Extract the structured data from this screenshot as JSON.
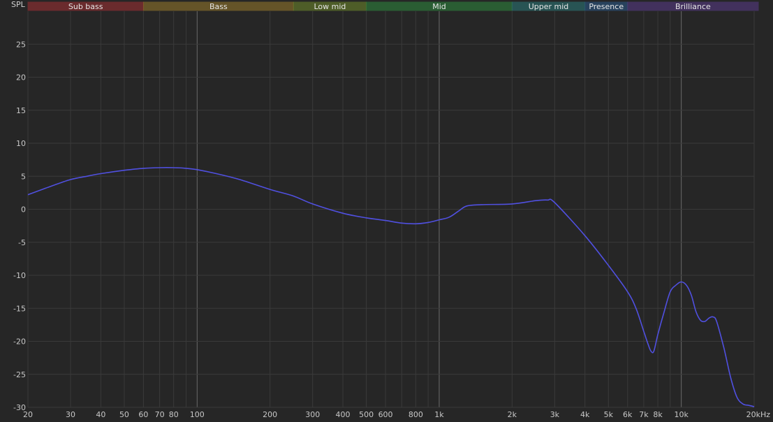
{
  "chart_data": {
    "type": "line",
    "ylabel": "SPL",
    "xlabel": "",
    "xscale": "log",
    "xlim": [
      20,
      20000
    ],
    "ylim": [
      -30,
      30
    ],
    "grid": true,
    "x_ticks": [
      {
        "value": 20,
        "label": "20"
      },
      {
        "value": 30,
        "label": "30"
      },
      {
        "value": 40,
        "label": "40"
      },
      {
        "value": 50,
        "label": "50"
      },
      {
        "value": 60,
        "label": "60"
      },
      {
        "value": 70,
        "label": "70"
      },
      {
        "value": 80,
        "label": "80"
      },
      {
        "value": 100,
        "label": "100"
      },
      {
        "value": 200,
        "label": "200"
      },
      {
        "value": 300,
        "label": "300"
      },
      {
        "value": 400,
        "label": "400"
      },
      {
        "value": 500,
        "label": "500"
      },
      {
        "value": 600,
        "label": "600"
      },
      {
        "value": 800,
        "label": "800"
      },
      {
        "value": 1000,
        "label": "1k"
      },
      {
        "value": 2000,
        "label": "2k"
      },
      {
        "value": 3000,
        "label": "3k"
      },
      {
        "value": 4000,
        "label": "4k"
      },
      {
        "value": 5000,
        "label": "5k"
      },
      {
        "value": 6000,
        "label": "6k"
      },
      {
        "value": 7000,
        "label": "7k"
      },
      {
        "value": 8000,
        "label": "8k"
      },
      {
        "value": 10000,
        "label": "10k"
      },
      {
        "value": 20000,
        "label": "20kHz"
      }
    ],
    "y_ticks": [
      {
        "value": 25,
        "label": "25"
      },
      {
        "value": 20,
        "label": "20"
      },
      {
        "value": 15,
        "label": "15"
      },
      {
        "value": 10,
        "label": "10"
      },
      {
        "value": 5,
        "label": "5"
      },
      {
        "value": 0,
        "label": "0"
      },
      {
        "value": -5,
        "label": "-5"
      },
      {
        "value": -10,
        "label": "-10"
      },
      {
        "value": -15,
        "label": "-15"
      },
      {
        "value": -20,
        "label": "-20"
      },
      {
        "value": -25,
        "label": "-25"
      },
      {
        "value": -30,
        "label": "-30"
      }
    ],
    "bands": [
      {
        "label": "Sub bass",
        "from": 20,
        "to": 60,
        "color": "#a33033"
      },
      {
        "label": "Bass",
        "from": 60,
        "to": 250,
        "color": "#9a7a2a"
      },
      {
        "label": "Low mid",
        "from": 250,
        "to": 500,
        "color": "#6f8a2a"
      },
      {
        "label": "Mid",
        "from": 500,
        "to": 2000,
        "color": "#2f8a3f"
      },
      {
        "label": "Upper mid",
        "from": 2000,
        "to": 4000,
        "color": "#2a7a7a"
      },
      {
        "label": "Presence",
        "from": 4000,
        "to": 6000,
        "color": "#2a5a8a"
      },
      {
        "label": "Brilliance",
        "from": 6000,
        "to": 20000,
        "color": "#5a3a8a"
      }
    ],
    "series": [
      {
        "color": "#5050e0",
        "x": [
          20,
          25,
          30,
          35,
          40,
          50,
          60,
          70,
          80,
          90,
          100,
          120,
          150,
          200,
          250,
          300,
          400,
          500,
          600,
          700,
          800,
          900,
          1000,
          1100,
          1200,
          1300,
          1500,
          2000,
          2500,
          2800,
          3000,
          4000,
          5000,
          6000,
          6500,
          7000,
          7300,
          7500,
          7700,
          8000,
          8500,
          9000,
          9500,
          10000,
          10500,
          11000,
          11500,
          12000,
          12500,
          13000,
          13500,
          14000,
          15000,
          16000,
          17000,
          18000,
          19000,
          20000
        ],
        "y": [
          2.2,
          3.5,
          4.5,
          5.0,
          5.4,
          5.9,
          6.2,
          6.3,
          6.3,
          6.2,
          6.0,
          5.4,
          4.5,
          3.0,
          2.0,
          0.8,
          -0.6,
          -1.3,
          -1.7,
          -2.1,
          -2.2,
          -2.0,
          -1.6,
          -1.2,
          -0.3,
          0.5,
          0.7,
          0.8,
          1.3,
          1.4,
          1.0,
          -4.0,
          -8.5,
          -12.5,
          -15.0,
          -18.5,
          -20.5,
          -21.5,
          -21.5,
          -19.0,
          -15.5,
          -12.5,
          -11.5,
          -11.0,
          -11.5,
          -13.0,
          -15.5,
          -16.8,
          -17.0,
          -16.5,
          -16.3,
          -17.0,
          -21.0,
          -25.5,
          -28.5,
          -29.5,
          -29.7,
          -29.9
        ]
      }
    ]
  }
}
